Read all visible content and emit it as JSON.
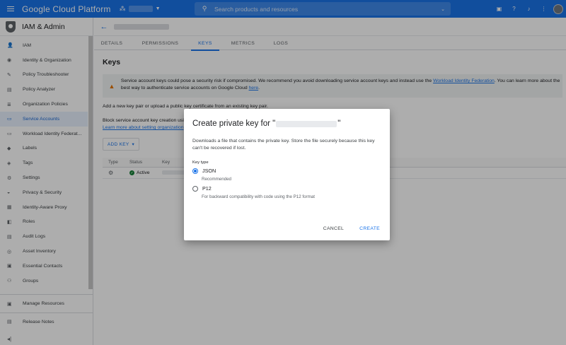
{
  "app": {
    "brand": "Google Cloud Platform",
    "search_placeholder": "Search products and resources"
  },
  "sidebar": {
    "title": "IAM & Admin",
    "items": [
      {
        "label": "IAM",
        "icon": "person-add-icon"
      },
      {
        "label": "Identity & Organization",
        "icon": "identity-icon"
      },
      {
        "label": "Policy Troubleshooter",
        "icon": "wrench-icon"
      },
      {
        "label": "Policy Analyzer",
        "icon": "document-search-icon"
      },
      {
        "label": "Organization Policies",
        "icon": "list-doc-icon"
      },
      {
        "label": "Service Accounts",
        "icon": "service-account-icon",
        "active": true
      },
      {
        "label": "Workload Identity Federat...",
        "icon": "monitor-icon"
      },
      {
        "label": "Labels",
        "icon": "label-icon"
      },
      {
        "label": "Tags",
        "icon": "tag-icon"
      },
      {
        "label": "Settings",
        "icon": "gear-icon"
      },
      {
        "label": "Privacy & Security",
        "icon": "shield-icon"
      },
      {
        "label": "Identity-Aware Proxy",
        "icon": "proxy-icon"
      },
      {
        "label": "Roles",
        "icon": "roles-icon"
      },
      {
        "label": "Audit Logs",
        "icon": "audit-icon"
      },
      {
        "label": "Asset Inventory",
        "icon": "inventory-icon"
      },
      {
        "label": "Essential Contacts",
        "icon": "contacts-icon"
      },
      {
        "label": "Groups",
        "icon": "groups-icon"
      }
    ],
    "bottom_items": [
      {
        "label": "Manage Resources",
        "icon": "folder-icon"
      },
      {
        "label": "Release Notes",
        "icon": "notes-icon"
      }
    ]
  },
  "tabs": [
    "DETAILS",
    "PERMISSIONS",
    "KEYS",
    "METRICS",
    "LOGS"
  ],
  "active_tab": "KEYS",
  "keys_page": {
    "title": "Keys",
    "warning_text_1": "Service account keys could pose a security risk if compromised. We recommend you avoid downloading service account keys and instead use the ",
    "warning_link_1": "Workload Identity Federation",
    "warning_text_2": ". You can learn more about the best way to authenticate service accounts on Google Cloud ",
    "warning_link_2": "here",
    "warning_text_3": ".",
    "add_key_info": "Add a new key pair or upload a public key certificate from an existing key pair.",
    "block_info": "Block service account key creation usi",
    "learn_more_link": "Learn more about setting organization",
    "add_key_button": "ADD KEY",
    "table_headers": [
      "Type",
      "Status",
      "Key"
    ],
    "row_status": "Active"
  },
  "dialog": {
    "title_prefix": "Create private key for \"",
    "title_suffix": "\"",
    "description": "Downloads a file that contains the private key. Store the file securely because this key can't be recovered if lost.",
    "key_type_label": "Key type",
    "options": [
      {
        "label": "JSON",
        "sub": "Recommended",
        "selected": true
      },
      {
        "label": "P12",
        "sub": "For backward compatibility with code using the P12 format",
        "selected": false
      }
    ],
    "cancel_label": "CANCEL",
    "create_label": "CREATE"
  }
}
